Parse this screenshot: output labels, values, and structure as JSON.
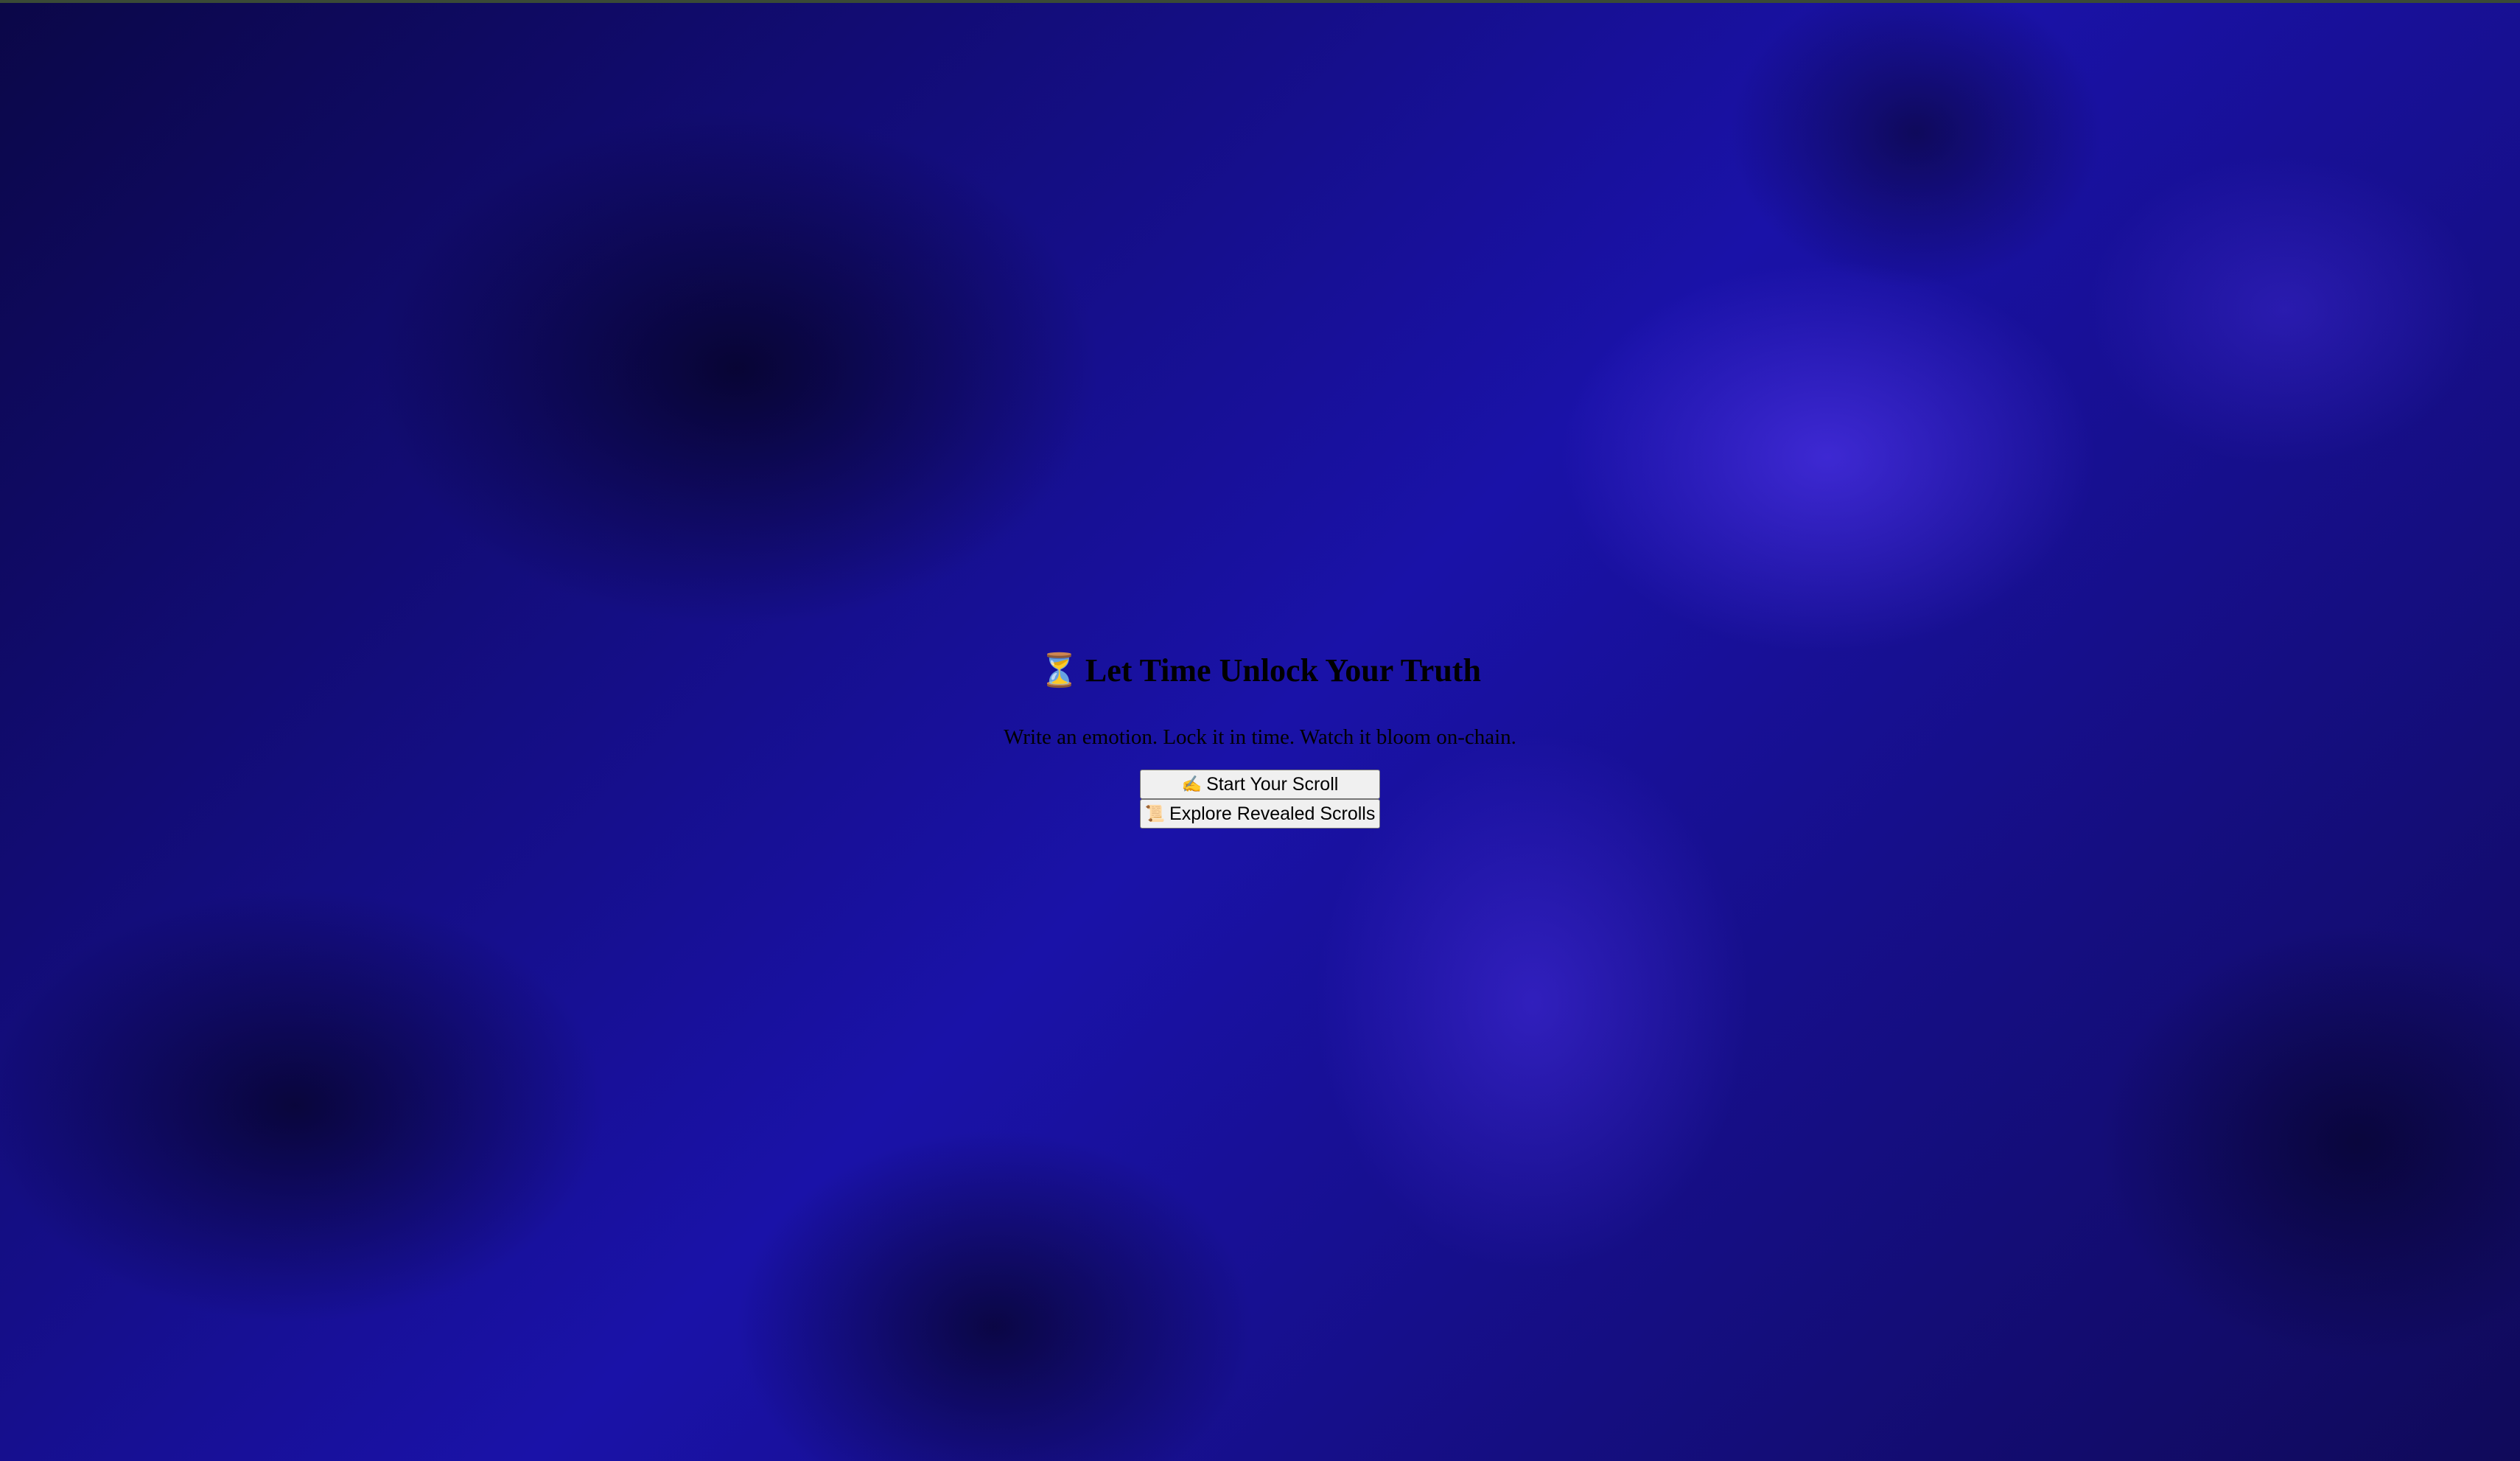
{
  "hero": {
    "title_icon": "⏳",
    "title": "Let Time Unlock Your Truth",
    "subtitle": "Write an emotion. Lock it in time. Watch it bloom on-chain."
  },
  "actions": {
    "start_icon": "✍️",
    "start_label": "Start Your Scroll",
    "explore_icon": "📜",
    "explore_label": "Explore Revealed Scrolls"
  },
  "colors": {
    "background": "#120c6a",
    "button_bg": "#f0f0f0",
    "text": "#000000"
  }
}
